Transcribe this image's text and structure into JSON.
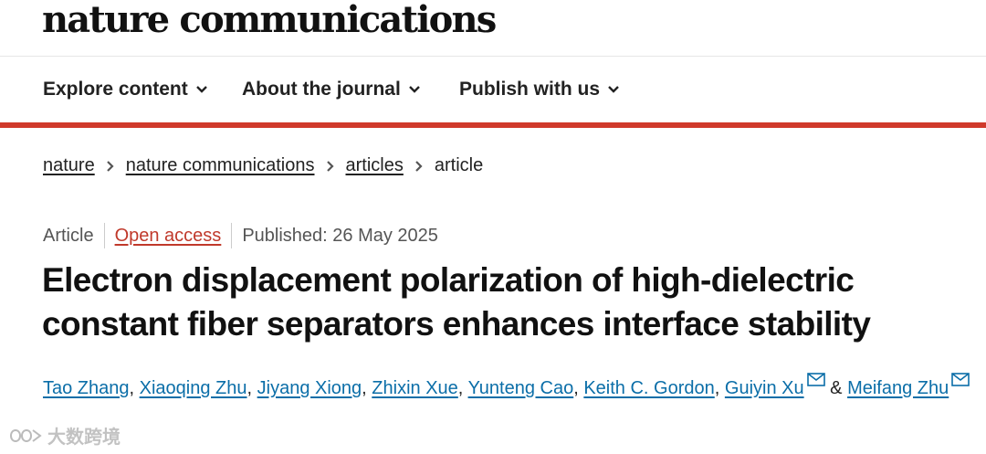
{
  "site": {
    "logo": "nature communications"
  },
  "nav": {
    "items": [
      {
        "label": "Explore content"
      },
      {
        "label": "About the journal"
      },
      {
        "label": "Publish with us"
      }
    ]
  },
  "breadcrumb": {
    "links": [
      "nature",
      "nature communications",
      "articles"
    ],
    "current": "article"
  },
  "meta": {
    "type": "Article",
    "access": "Open access",
    "published": "Published: 26 May 2025"
  },
  "article": {
    "title": "Electron displacement polarization of high-dielectric constant fiber separators enhances interface stability"
  },
  "authors": {
    "list": [
      "Tao Zhang",
      "Xiaoqing Zhu",
      "Jiyang Xiong",
      "Zhixin Xue",
      "Yunteng Cao",
      "Keith C. Gordon",
      "Guiyin Xu",
      "Meifang Zhu"
    ],
    "separator": ", ",
    "ampersand": "&"
  },
  "watermark": {
    "text": "大数跨境"
  },
  "colors": {
    "accent": "#d0392b",
    "link": "#0b6ea8",
    "open_access": "#c0392b"
  },
  "icons": {
    "nav_caret": "chevron-down-icon",
    "crumb_sep": "chevron-right-icon",
    "corresponding": "mail-icon"
  }
}
